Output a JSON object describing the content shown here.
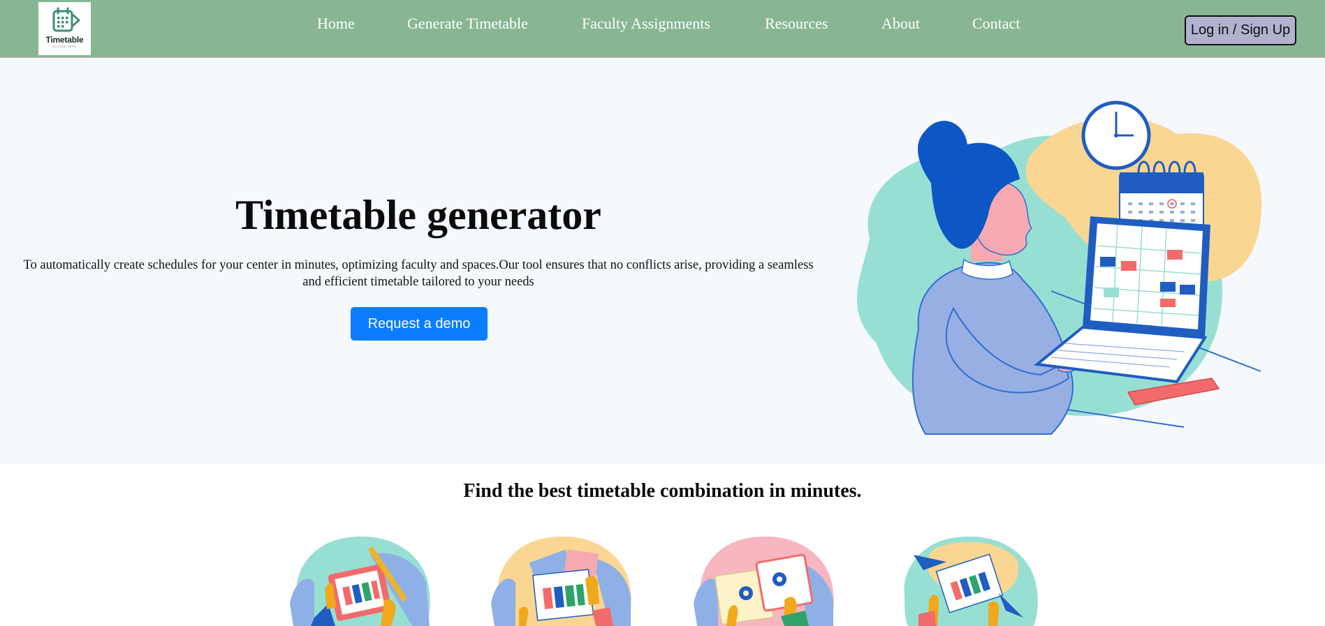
{
  "brand": {
    "logo_text": "Timetable",
    "logo_sub": "SLOGAN HERE"
  },
  "nav": {
    "links": [
      "Home",
      "Generate Timetable",
      "Faculty Assignments",
      "Resources",
      "About",
      "Contact"
    ],
    "login_label": "Log in / Sign Up"
  },
  "hero": {
    "title": "Timetable generator",
    "description": "To automatically create schedules for your center in minutes, optimizing faculty and spaces.Our tool ensures that no conflicts arise, providing a seamless and efficient timetable tailored to your needs",
    "cta_label": "Request a demo",
    "illustration": "person-at-laptop-with-calendar-and-clock"
  },
  "features": {
    "title": "Find the best timetable combination in minutes.",
    "items": [
      {
        "icon": "tablet-timetable-illustration"
      },
      {
        "icon": "documents-timetable-illustration"
      },
      {
        "icon": "settings-gears-illustration"
      },
      {
        "icon": "paper-plane-timetable-illustration"
      }
    ]
  },
  "colors": {
    "navbar_bg": "#88b693",
    "login_bg": "#b2b1ce",
    "cta_bg": "#0a7cff",
    "hero_bg": "#f5f8fd"
  }
}
